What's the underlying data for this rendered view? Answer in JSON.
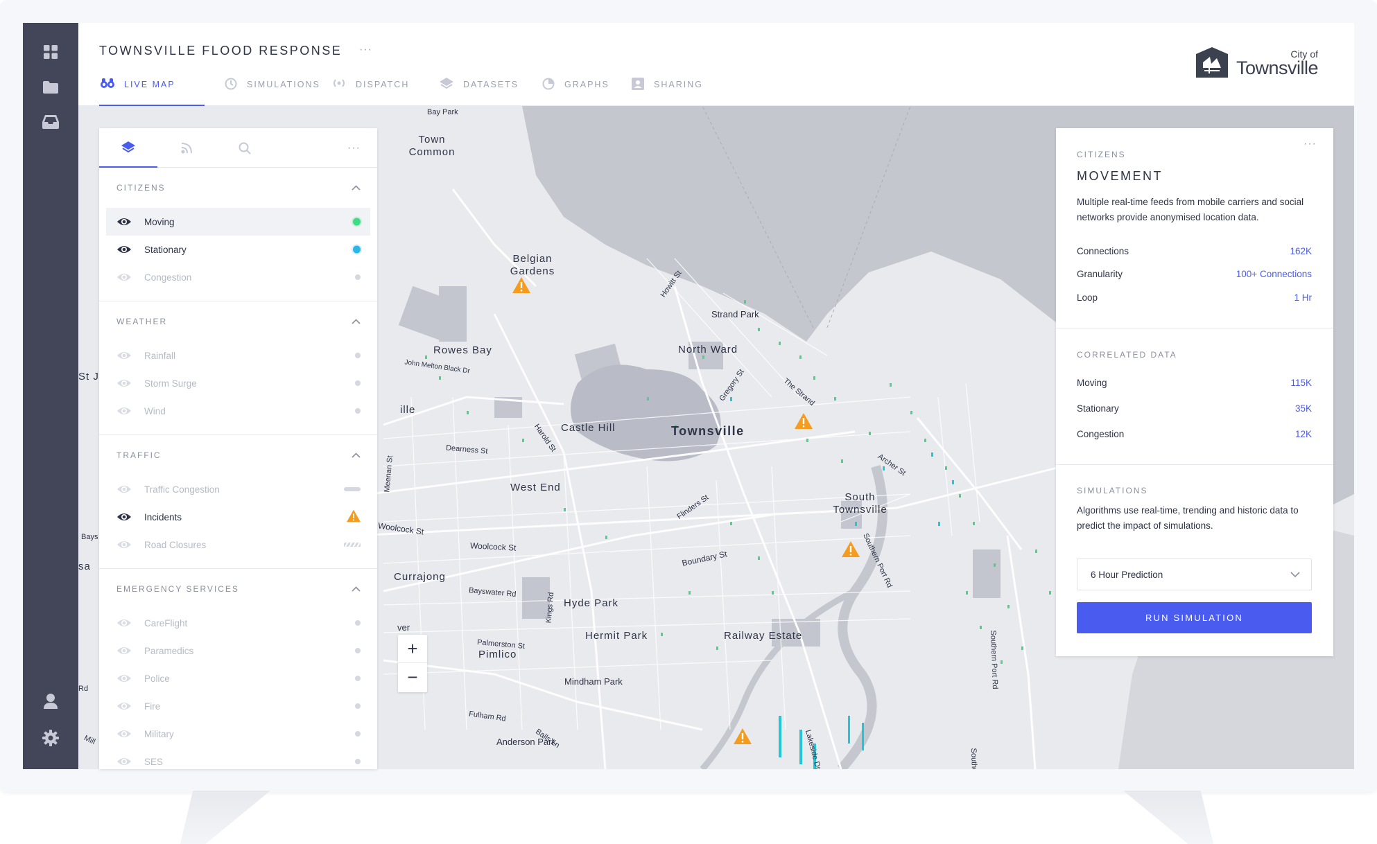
{
  "app": {
    "title": "TOWNSVILLE FLOOD RESPONSE",
    "more": "···"
  },
  "tabs": [
    {
      "label": "LIVE MAP",
      "icon": "binoculars-icon",
      "active": true
    },
    {
      "label": "SIMULATIONS",
      "icon": "clock-icon",
      "active": false
    },
    {
      "label": "DISPATCH",
      "icon": "broadcast-icon",
      "active": false
    },
    {
      "label": "DATASETS",
      "icon": "layers-icon",
      "active": false
    },
    {
      "label": "GRAPHS",
      "icon": "pie-chart-icon",
      "active": false
    },
    {
      "label": "SHARING",
      "icon": "contact-card-icon",
      "active": false
    }
  ],
  "logo": {
    "small": "City of",
    "big": "Townsville"
  },
  "rail": {
    "icons": [
      "dashboard-grid-icon",
      "folder-icon",
      "inbox-icon",
      "user-icon",
      "gear-icon"
    ]
  },
  "layers_panel": {
    "tabs": [
      "layers-icon",
      "feed-icon",
      "search-icon"
    ],
    "more": "···",
    "sections": [
      {
        "title": "CITIZENS",
        "items": [
          {
            "label": "Moving",
            "visible": true,
            "indicator": "dot",
            "color": "#3ddc84"
          },
          {
            "label": "Stationary",
            "visible": true,
            "indicator": "dot",
            "color": "#29b6e8"
          },
          {
            "label": "Congestion",
            "visible": false,
            "indicator": "dot",
            "color": "#d5d8e0"
          }
        ]
      },
      {
        "title": "WEATHER",
        "items": [
          {
            "label": "Rainfall",
            "visible": false,
            "indicator": "dot",
            "color": "#d5d8e0"
          },
          {
            "label": "Storm Surge",
            "visible": false,
            "indicator": "dot",
            "color": "#d5d8e0"
          },
          {
            "label": "Wind",
            "visible": false,
            "indicator": "dot",
            "color": "#d5d8e0"
          }
        ]
      },
      {
        "title": "TRAFFIC",
        "items": [
          {
            "label": "Traffic Congestion",
            "visible": false,
            "indicator": "line",
            "color": "#d5d8e0"
          },
          {
            "label": "Incidents",
            "visible": true,
            "indicator": "warning",
            "color": "#f59b1e"
          },
          {
            "label": "Road Closures",
            "visible": false,
            "indicator": "hatch",
            "color": "#d5d8e0"
          }
        ]
      },
      {
        "title": "EMERGENCY SERVICES",
        "items": [
          {
            "label": "CareFlight",
            "visible": false,
            "indicator": "dot",
            "color": "#d5d8e0"
          },
          {
            "label": "Paramedics",
            "visible": false,
            "indicator": "dot",
            "color": "#d5d8e0"
          },
          {
            "label": "Police",
            "visible": false,
            "indicator": "dot",
            "color": "#d5d8e0"
          },
          {
            "label": "Fire",
            "visible": false,
            "indicator": "dot",
            "color": "#d5d8e0"
          },
          {
            "label": "Military",
            "visible": false,
            "indicator": "dot",
            "color": "#d5d8e0"
          },
          {
            "label": "SES",
            "visible": false,
            "indicator": "dot",
            "color": "#d5d8e0"
          }
        ]
      }
    ]
  },
  "info_panel": {
    "more": "···",
    "eyebrow": "CITIZENS",
    "title": "MOVEMENT",
    "description": "Multiple real-time feeds from mobile carriers and social networks provide anonymised location data.",
    "stats": [
      {
        "label": "Connections",
        "value": "162K"
      },
      {
        "label": "Granularity",
        "value": "100+ Connections"
      },
      {
        "label": "Loop",
        "value": "1 Hr"
      }
    ],
    "correlated_title": "CORRELATED DATA",
    "correlated": [
      {
        "label": "Moving",
        "value": "115K"
      },
      {
        "label": "Stationary",
        "value": "35K"
      },
      {
        "label": "Congestion",
        "value": "12K"
      }
    ],
    "simulations_title": "SIMULATIONS",
    "simulations_desc": "Algorithms use real-time, trending and historic data to predict the impact of simulations.",
    "select_value": "6 Hour Prediction",
    "run_label": "RUN SIMULATION"
  },
  "zoom": {
    "plus": "+",
    "minus": "−"
  },
  "map_labels": {
    "bay_park": "Bay Park",
    "town_common": "Town Common",
    "belgian_gardens": "Belgian Gardens",
    "rowes_bay": "Rowes Bay",
    "north_ward": "North Ward",
    "castle_hill": "Castle Hill",
    "townsville": "Townsville",
    "west_end": "West End",
    "south_townsville": "South Townsville",
    "currajong": "Currajong",
    "hyde_park": "Hyde Park",
    "hermit_park": "Hermit Park",
    "railway_estate": "Railway Estate",
    "pimlico": "Pimlico",
    "mindham_park": "Mindham Park",
    "anderson_park": "Anderson Park",
    "strand_park": "Strand Park",
    "howitt_st": "Howitt St",
    "gregory_st": "Gregory St",
    "the_strand": "The Strand",
    "archer_st": "Archer St",
    "harold_st": "Harold St",
    "dearness_st": "Dearness St",
    "meenan_st": "Meenan St",
    "woolcock_st": "Woolcock St",
    "flinders_st": "Flinders St",
    "boundary_st": "Boundary St",
    "bayswater_rd": "Bayswater Rd",
    "kings_rd": "Kings Rd",
    "palmerston_st": "Palmerston St",
    "fulham_rd": "Fulham Rd",
    "balls_ln": "Balls Ln",
    "southern_port_rd": "Southern Port Rd",
    "lakeside_dr": "Lakeside Dr",
    "john_melton": "John Melton Black Dr",
    "st_j": "St J",
    "ille": "ille",
    "bays": "Bays",
    "sa": "sa",
    "ver": "ver",
    "rd": "Rd",
    "mill": "Mill",
    "southe": "Southe"
  },
  "incidents": [
    {
      "name": "incident-north"
    },
    {
      "name": "incident-townsville"
    },
    {
      "name": "incident-south-townsville"
    },
    {
      "name": "incident-lakeside"
    }
  ]
}
